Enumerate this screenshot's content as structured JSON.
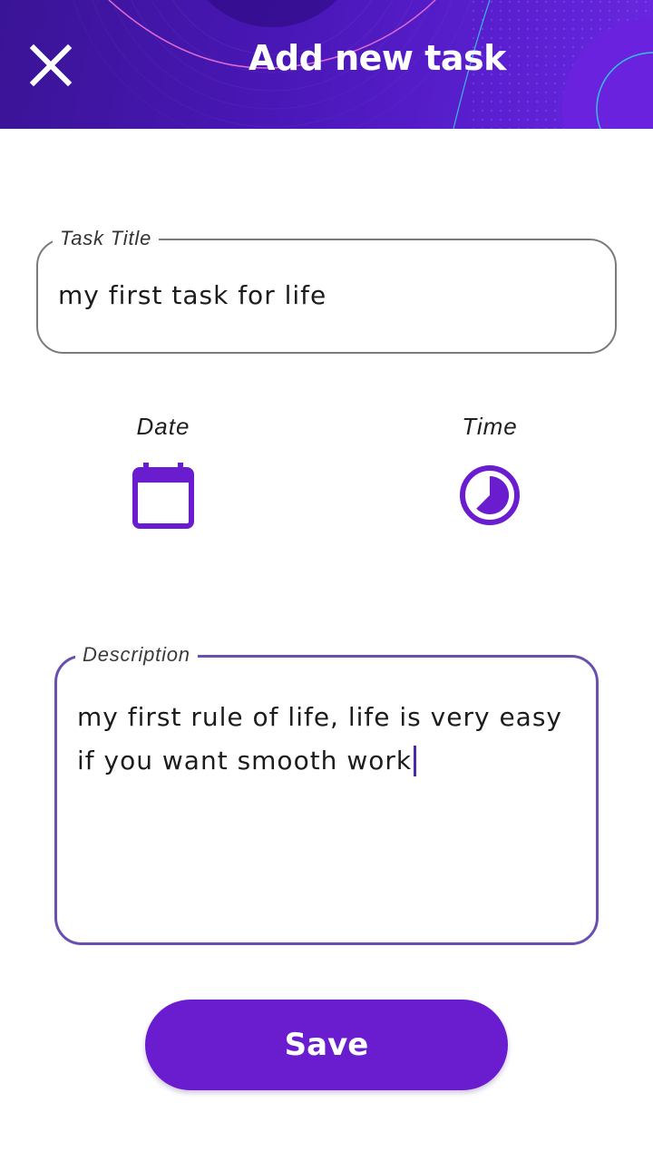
{
  "header": {
    "title": "Add new task",
    "close_icon": "close-icon",
    "colors": {
      "gradient_start": "#3a1496",
      "gradient_end": "#6a28e0"
    }
  },
  "task_title": {
    "label": "Task Title",
    "value": "my first task for life"
  },
  "date": {
    "label": "Date",
    "icon": "calendar-icon"
  },
  "time": {
    "label": "Time",
    "icon": "clock-icon"
  },
  "description": {
    "label": "Description",
    "value": "my first rule of life, life is very easy if you want smooth work",
    "focused": true
  },
  "save": {
    "label": "Save"
  },
  "colors": {
    "accent": "#6a1ccf",
    "focused_outline": "#6a4fb0",
    "outline": "#7b7b7b"
  }
}
